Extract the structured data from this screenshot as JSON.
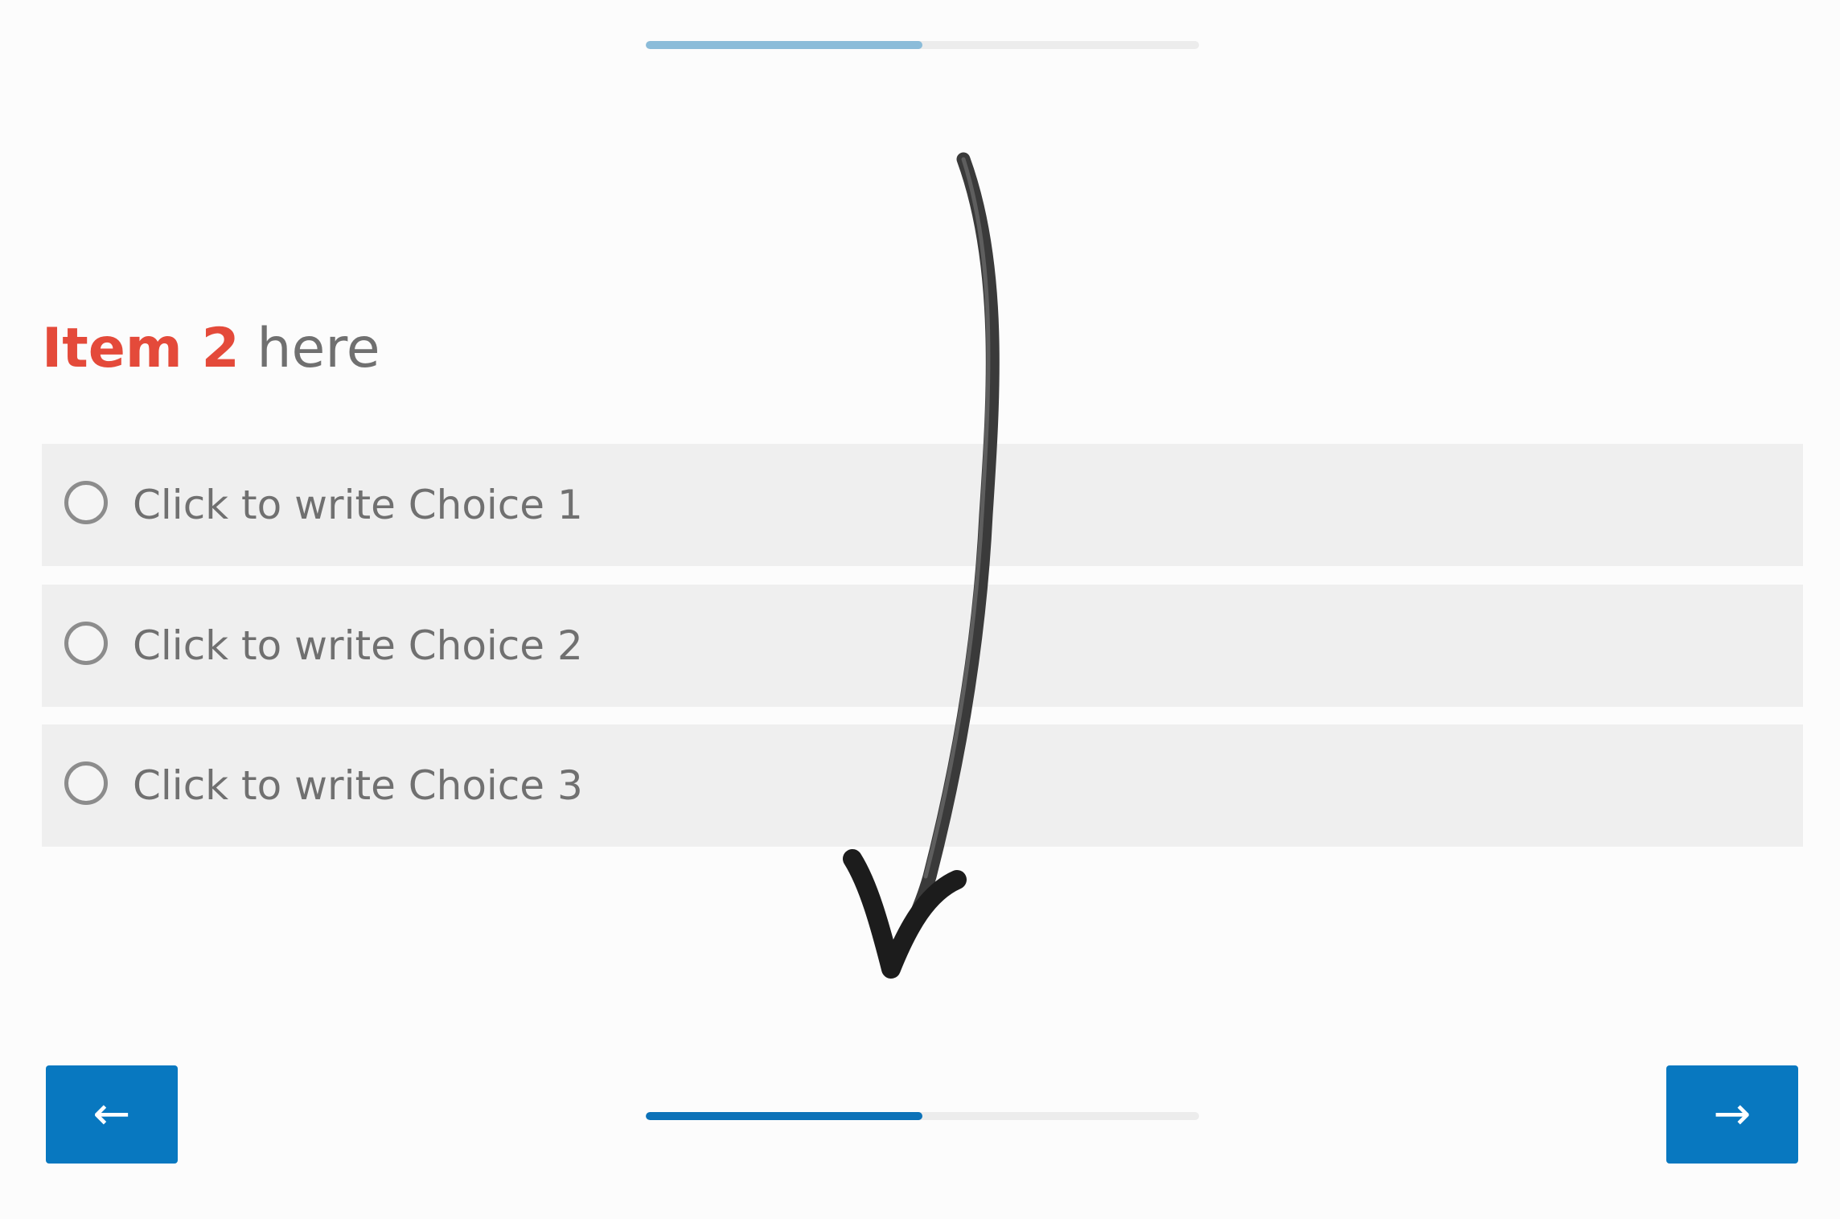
{
  "progress": {
    "top_fraction": 0.5,
    "bottom_fraction": 0.5
  },
  "question": {
    "item_label": "Item 2",
    "rest": " here"
  },
  "choices": [
    {
      "label": "Click to write Choice 1"
    },
    {
      "label": "Click to write Choice 2"
    },
    {
      "label": "Click to write Choice 3"
    }
  ],
  "nav": {
    "back_label": "←",
    "next_label": "→"
  },
  "colors": {
    "accent": "#0878c0",
    "item_highlight": "#e44a3a",
    "progress_top": "#8bbcd9",
    "progress_bottom": "#0c72b8",
    "choice_background": "#efefef"
  },
  "annotation": {
    "icon": "hand-drawn-arrow-down-icon"
  }
}
